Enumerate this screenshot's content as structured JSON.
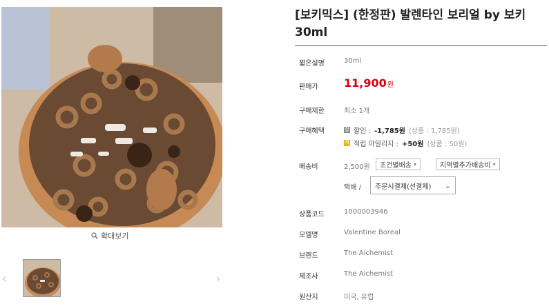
{
  "product": {
    "title": "[보키믹스] (한정판) 발렌타인 보리얼 by 보키 30ml"
  },
  "gallery": {
    "zoom_label": "확대보기",
    "prev_arrow": "‹",
    "next_arrow": "›"
  },
  "info": {
    "short_desc": {
      "label": "짧은설명",
      "value": "30ml"
    },
    "price": {
      "label": "판매가",
      "value": "11,900",
      "unit": "원"
    },
    "limit": {
      "label": "구매제한",
      "value": "최소 1개"
    },
    "benefit": {
      "label": "구매혜택",
      "discount_badge": "할",
      "discount_prefix": "할인 :",
      "discount_amount": "-1,785원",
      "discount_sub": "(상품 : 1,785원)",
      "mileage_badge": "적",
      "mileage_prefix": "적립 마일리지 :",
      "mileage_amount": "+50원",
      "mileage_sub": "(상품 : 50원)"
    },
    "shipping": {
      "label": "배송비",
      "value": "2,500원",
      "condition_select": "조건별배송",
      "regional_select": "지역별추가배송비",
      "courier": "택배 /",
      "payment_select": "주문시결제(선결제)"
    },
    "code": {
      "label": "상품코드",
      "value": "1000003946"
    },
    "model": {
      "label": "모델명",
      "value": "Valentine Boreal"
    },
    "brand": {
      "label": "브랜드",
      "value": "The Alchemist"
    },
    "maker": {
      "label": "제조사",
      "value": "The Alchemist"
    },
    "origin": {
      "label": "원산지",
      "value": "미국, 유럽"
    }
  },
  "icons": {
    "zoom": "magnifier-icon",
    "prev": "chevron-left-icon",
    "next": "chevron-right-icon",
    "dropdown": "chevron-down-icon"
  }
}
